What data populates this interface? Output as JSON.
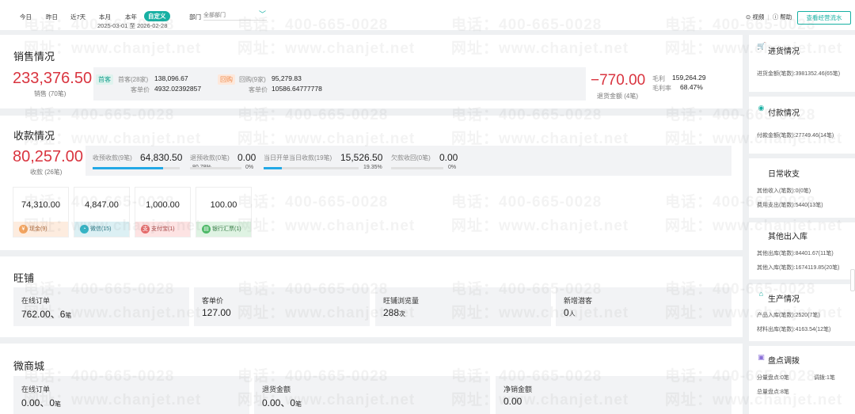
{
  "filters": {
    "items": [
      "今日",
      "昨日",
      "近7天",
      "本月",
      "本年",
      "自定义"
    ],
    "date_range": "2025-03-01 至 2026-02-28",
    "dept_label": "部门",
    "dept_placeholder": "全部部门"
  },
  "top_right": {
    "video": "视频",
    "help": "帮助",
    "flow_button": "查看经营流水"
  },
  "sales": {
    "title": "销售情况",
    "amount": "233,376.50",
    "amount_sub": "销售 (70笔)",
    "first_tag": "首客",
    "first_label": "首客(28家)",
    "first_value": "138,096.67",
    "first_unit_label": "客单价",
    "first_unit_value": "4932.02392857",
    "repeat_tag": "回购",
    "repeat_label": "回购(9家)",
    "repeat_value": "95,279.83",
    "repeat_unit_label": "客单价",
    "repeat_unit_value": "10586.64777778",
    "return_amount": "−770.00",
    "return_label": "退货金额 (4笔)",
    "gross_label": "毛利",
    "gross_value": "159,264.29",
    "margin_label": "毛利率",
    "margin_value": "68.47%"
  },
  "receipts": {
    "title": "收款情况",
    "amount": "80,257.00",
    "amount_sub": "收款 (26笔)",
    "items": [
      {
        "label": "收预收款(9笔)",
        "value": "64,830.50",
        "pct": "80.78%",
        "fill": 0.8078
      },
      {
        "label": "退预收款(0笔)",
        "value": "0.00",
        "pct": "0%",
        "fill": 0
      },
      {
        "label": "当日开单当日收款(19笔)",
        "value": "15,526.50",
        "pct": "19.35%",
        "fill": 0.1935
      },
      {
        "label": "欠款收回(0笔)",
        "value": "0.00",
        "pct": "0%",
        "fill": 0
      }
    ],
    "methods": [
      {
        "amount": "74,310.00",
        "label": "现金(9)",
        "icon": "yuan-icon"
      },
      {
        "amount": "4,847.00",
        "label": "微信(15)",
        "icon": "wechat-icon"
      },
      {
        "amount": "1,000.00",
        "label": "支付宝(1)",
        "icon": "alipay-icon"
      },
      {
        "amount": "100.00",
        "label": "银行汇票(1)",
        "icon": "bank-icon"
      }
    ]
  },
  "wangpu": {
    "title": "旺铺",
    "stats": [
      {
        "label": "在线订单",
        "value": "762.00、6",
        "unit": "笔"
      },
      {
        "label": "客单价",
        "value": "127.00",
        "unit": ""
      },
      {
        "label": "旺铺浏览量",
        "value": "288",
        "unit": "次"
      },
      {
        "label": "新增潜客",
        "value": "0",
        "unit": "人"
      }
    ]
  },
  "weishop": {
    "title": "微商城",
    "stats": [
      {
        "label": "在线订单",
        "value": "0.00、0",
        "unit": "笔"
      },
      {
        "label": "退货金额",
        "value": "0.00、0",
        "unit": "笔"
      },
      {
        "label": "净销金额",
        "value": "0.00",
        "unit": ""
      }
    ]
  },
  "right": {
    "purchase": {
      "title": "进货情况",
      "lines": [
        "进货金额(笔数):3981352.46(65笔)"
      ]
    },
    "payment": {
      "title": "付款情况",
      "lines": [
        "付款金额(笔数):27749.46(14笔)"
      ]
    },
    "daily": {
      "title": "日常收支",
      "lines": [
        "其他收入(笔数):0(0笔)",
        "费用支出(笔数):5440(13笔)"
      ]
    },
    "inout": {
      "title": "其他出入库",
      "lines": [
        "其他出库(笔数):84401.67(11笔)",
        "其他入库(笔数):1674119.85(20笔)"
      ]
    },
    "production": {
      "title": "生产情况",
      "lines": [
        "产品入库(笔数):2520(7笔)",
        "材料出库(笔数):4163.54(12笔)"
      ]
    },
    "stock": {
      "title": "盘点调拨",
      "lines": [
        "分量盘点:0笔",
        "调拨:1笔",
        "总量盘点:8笔"
      ]
    }
  },
  "watermark": {
    "phone": "电话：400-665-0028",
    "site": "网址：www.chanjet.net"
  },
  "colors": {
    "accent": "#17b0a3",
    "red": "#d9343f",
    "progress": "#23a9e6"
  }
}
